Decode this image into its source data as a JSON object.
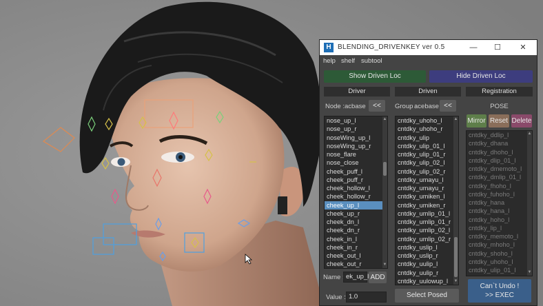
{
  "window": {
    "title": "BLENDING_DRIVENKEY  ver 0.5",
    "logo_glyph": "H",
    "minimize": "—",
    "maximize": "☐",
    "close": "✕"
  },
  "menu": [
    "help",
    "shelf",
    "subtool"
  ],
  "toolbar": {
    "show_driven_loc": "Show Driven Loc",
    "hide_driven_loc": "Hide Driven Loc"
  },
  "columns": {
    "driver": "Driver",
    "driven": "Driven",
    "registration": "Registration"
  },
  "driver": {
    "node_label": "Node :",
    "node_value": "acbase",
    "load_btn": "<<",
    "items": [
      "nose_up_l",
      "nose_up_r",
      "noseWing_up_l",
      "noseWing_up_r",
      "nose_flare",
      "nose_close",
      "cheek_puff_l",
      "cheek_puff_r",
      "cheek_hollow_l",
      "cheek_hollow_r",
      "cheek_up_l",
      "cheek_up_r",
      "cheek_dn_l",
      "cheek_dn_r",
      "cheek_in_l",
      "cheek_in_r",
      "cheek_out_l",
      "cheek_out_r"
    ],
    "selected": "cheek_up_l",
    "name_label": "Name :",
    "name_value": "ek_up_l",
    "add_btn": "ADD",
    "value_label": "Value :",
    "value_value": "1.0"
  },
  "driven": {
    "group_label": "Group :",
    "group_value": "acebase",
    "load_btn": "<<",
    "items": [
      "cntdky_uhoho_l",
      "cntdky_uhoho_r",
      "cntdky_ulip",
      "cntdky_ulip_01_l",
      "cntdky_ulip_01_r",
      "cntdky_ulip_02_l",
      "cntdky_ulip_02_r",
      "cntdky_umayu_l",
      "cntdky_umayu_r",
      "cntdky_umiken_l",
      "cntdky_umiken_r",
      "cntdky_umlip_01_l",
      "cntdky_umlip_01_r",
      "cntdky_umlip_02_l",
      "cntdky_umlip_02_r",
      "cntdky_uslip_l",
      "cntdky_uslip_r",
      "cntdky_uulip_l",
      "cntdky_uulip_r",
      "cntdky_uulowup_l"
    ],
    "select_posed_btn": "Select Posed"
  },
  "registration": {
    "pose_label": "POSE",
    "mirror_btn": "Mirror",
    "reset_btn": "Reset",
    "delete_btn": "Delete",
    "items": [
      "cntdky_ddlip_l",
      "cntdky_dhana",
      "cntdky_dhoho_l",
      "cntdky_dlip_01_l",
      "cntdky_dmemoto_l",
      "cntdky_dmlip_01_l",
      "cntdky_fhoho_l",
      "cntdky_fuhoho_l",
      "cntdky_hana",
      "cntdky_hana_l",
      "cntdky_hoho_l",
      "cntdky_lip_l",
      "cntdky_memoto_l",
      "cntdky_mhoho_l",
      "cntdky_shoho_l",
      "cntdky_uhoho_l",
      "cntdky_ulip_01_l"
    ],
    "exec_line1": "Can`t Undo !",
    "exec_line2": ">> EXEC"
  },
  "colors": {
    "show_btn": "#2d5a37",
    "hide_btn": "#3d3d7e",
    "mirror_btn": "#5e7e4a",
    "reset_btn": "#8a6e5a",
    "delete_btn": "#8a4a6a",
    "exec_btn": "#3a5f8a",
    "selection": "#5a8fbf"
  }
}
